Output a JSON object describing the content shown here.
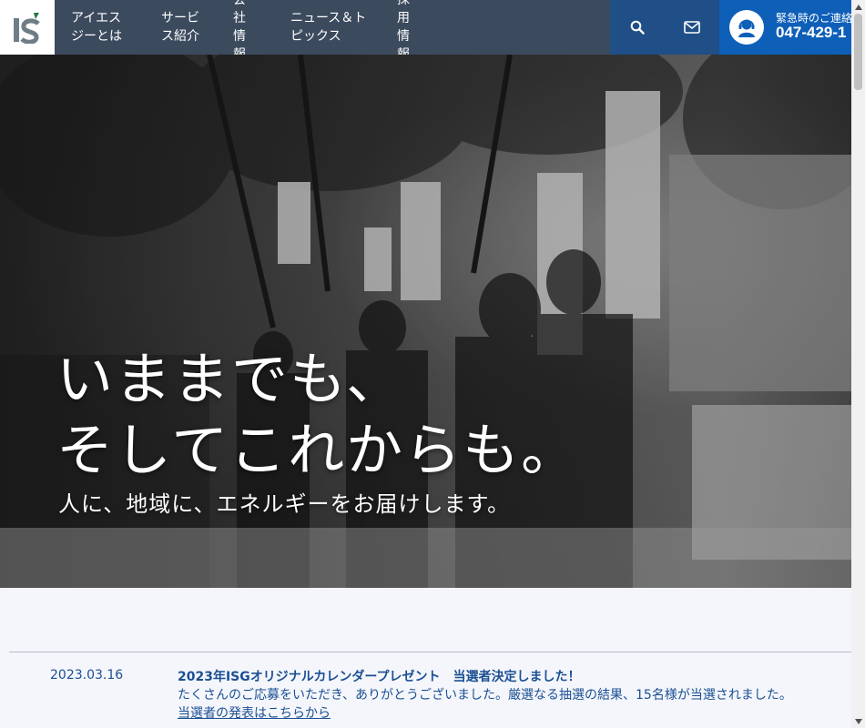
{
  "header": {
    "logo_text": "IS",
    "nav": [
      {
        "label": "アイエスジーとは",
        "lines": [
          "アイエス",
          "ジーとは"
        ]
      },
      {
        "label": "サービス紹介",
        "lines": [
          "サービ",
          "ス紹介"
        ]
      },
      {
        "label": "会社情報",
        "lines": [
          "会",
          "社",
          "情",
          "報"
        ]
      },
      {
        "label": "ニュース＆トピックス",
        "lines": [
          "ニュース＆ト",
          "ピックス"
        ]
      },
      {
        "label": "採用情報",
        "lines": [
          "採",
          "用",
          "情",
          "報"
        ]
      }
    ],
    "search_icon": "search-icon",
    "mail_icon": "mail-icon",
    "contact": {
      "label": "緊急時のご連絡",
      "phone": "047-429-1"
    }
  },
  "hero": {
    "title_line1": "いままでも、",
    "title_line2": "そしてこれからも。",
    "subtitle": "人に、地域に、エネルギーをお届けします。"
  },
  "news": {
    "date": "2023.03.16",
    "title": "2023年ISGオリジナルカレンダープレゼント　当選者決定しました！",
    "body": "たくさんのご応募をいただき、ありがとうございました。厳選なる抽選の結果、15名様が当選されました。",
    "link": "当選者の発表はこちらから"
  },
  "colors": {
    "header_bg": "#3c4a5e",
    "icon_bg": "#1f4f86",
    "contact_bg": "#0e5fb8",
    "news_text": "#1b4f93",
    "news_bg": "#f4f6fb"
  }
}
